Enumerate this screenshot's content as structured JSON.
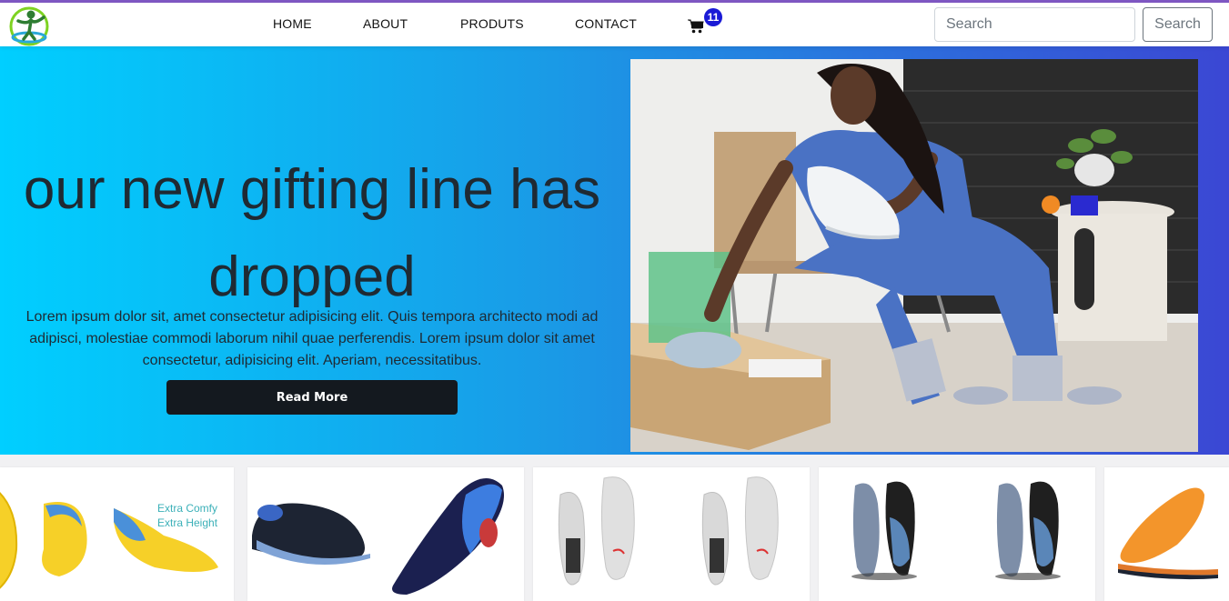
{
  "nav": {
    "links": [
      "HOME",
      "ABOUT",
      "PRODUTS",
      "CONTACT"
    ],
    "cart_count": "11",
    "search_placeholder": "Search",
    "search_button": "Search"
  },
  "hero": {
    "title": "our new gifting line has dropped",
    "text": "Lorem ipsum dolor sit, amet consectetur adipisicing elit. Quis tempora architecto modi ad adipisci, molestiae commodi laborum nihil quae perferendis. Lorem ipsum dolor sit amet consectetur, adipisicing elit. Aperiam, necessitatibus.",
    "button": "Read More"
  },
  "products": {
    "card1_text_line1": "Extra Comfy",
    "card1_text_line2": "Extra Height"
  },
  "colors": {
    "accent_line": "#7e57c2",
    "badge": "#1a1ad6",
    "hero_gradient_start": "#00cfff",
    "hero_gradient_end": "#3b47d4",
    "button_dark": "#14191f"
  }
}
